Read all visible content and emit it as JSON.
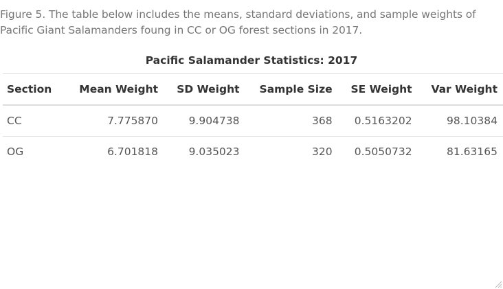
{
  "caption": "Figure 5. The table below includes the means, standard deviations, and sample weights of Pacific Giant Salamanders foung in CC or OG forest sections in 2017.",
  "table": {
    "title": "Pacific Salamander Statistics: 2017",
    "columns": [
      "Section",
      "Mean Weight",
      "SD Weight",
      "Sample Size",
      "SE Weight",
      "Var Weight"
    ],
    "rows": [
      [
        "CC",
        "7.775870",
        "9.904738",
        "368",
        "0.5163202",
        "98.10384"
      ],
      [
        "OG",
        "6.701818",
        "9.035023",
        "320",
        "0.5050732",
        "81.63165"
      ]
    ]
  },
  "icons": {
    "resize_grip": "resize-grip-icon"
  }
}
